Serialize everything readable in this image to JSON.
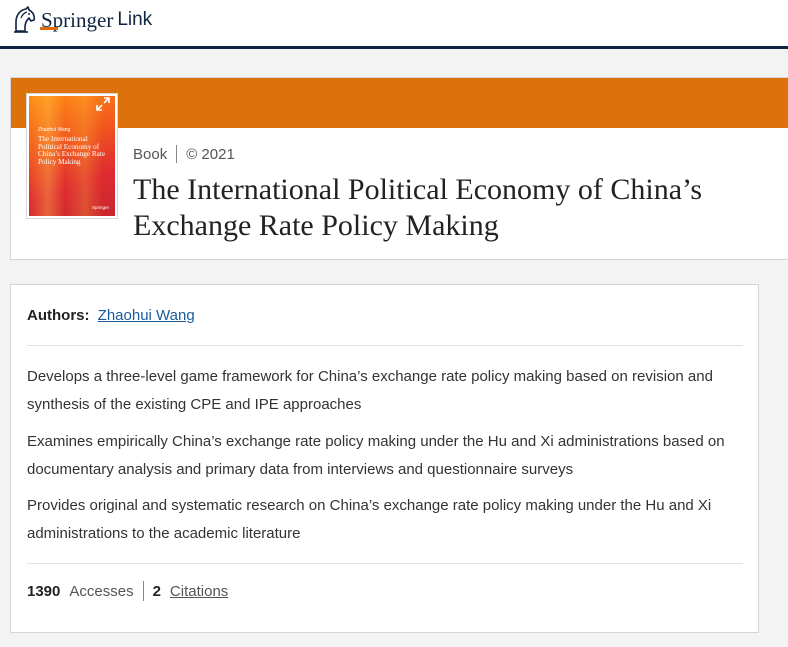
{
  "header": {
    "logo_text": "Springer",
    "logo_suffix": "Link",
    "logo_icon": "springer-horse-icon",
    "rule_color": "#0f2440",
    "accent_color": "#e36a0c"
  },
  "book": {
    "band_color": "#dd720c",
    "cover": {
      "author": "Zhaohui Wang",
      "title": "The International Political Economy of China’s Exchange Rate Policy Making",
      "publisher": "Springer"
    },
    "type": "Book",
    "year": "© 2021",
    "title": "The International Political Economy of China’s Exchange Rate Policy Making",
    "expand_icon": "expand-icon"
  },
  "details": {
    "authors_label": "Authors:",
    "author": "Zhaohui Wang",
    "bullets": [
      "Develops a three-level game framework for China’s exchange rate policy making based on revision and synthesis of the existing CPE and IPE approaches",
      "Examines empirically China’s exchange rate policy making under the Hu and Xi administrations based on documentary analysis and primary data from interviews and questionnaire surveys",
      "Provides original and systematic research on China’s exchange rate policy making under the Hu and Xi administrations to the academic literature"
    ],
    "accesses_count": "1390",
    "accesses_label": "Accesses",
    "citations_count": "2",
    "citations_label": "Citations",
    "link_color": "#1a5b9c"
  }
}
